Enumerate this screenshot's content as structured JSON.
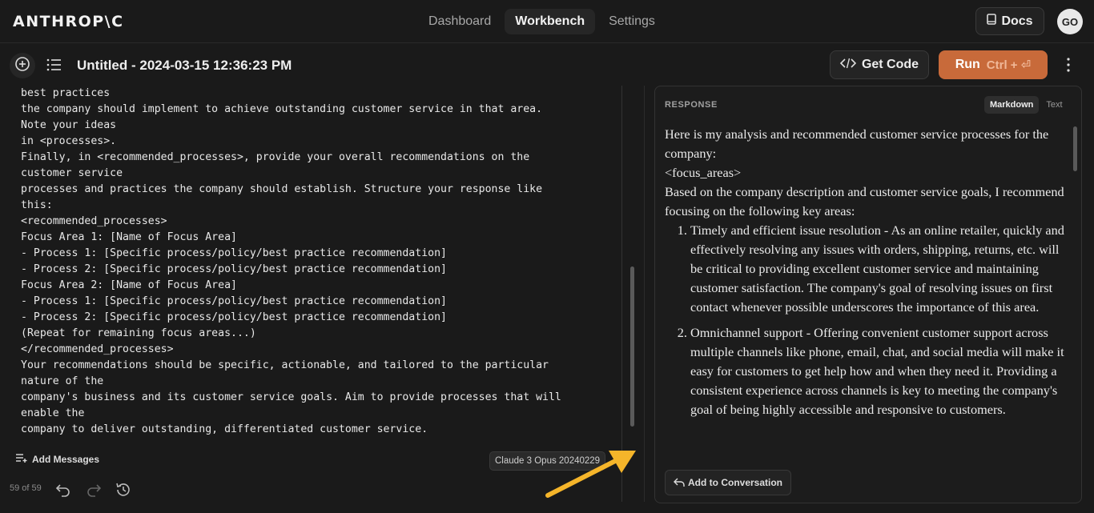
{
  "topnav": {
    "logo": "ANTHROP\\C",
    "tabs": [
      {
        "label": "Dashboard",
        "active": false
      },
      {
        "label": "Workbench",
        "active": true
      },
      {
        "label": "Settings",
        "active": false
      }
    ],
    "docs_label": "Docs",
    "avatar_initials": "GO"
  },
  "toolbar": {
    "title": "Untitled - 2024-03-15 12:36:23 PM",
    "get_code_label": "Get Code",
    "run_label": "Run",
    "run_shortcut": "Ctrl + ⏎"
  },
  "prompt": {
    "text": "best practices\nthe company should implement to achieve outstanding customer service in that area.\nNote your ideas\nin <processes>.\nFinally, in <recommended_processes>, provide your overall recommendations on the\ncustomer service\nprocesses and practices the company should establish. Structure your response like\nthis:\n<recommended_processes>\nFocus Area 1: [Name of Focus Area]\n- Process 1: [Specific process/policy/best practice recommendation]\n- Process 2: [Specific process/policy/best practice recommendation]\nFocus Area 2: [Name of Focus Area]\n- Process 1: [Specific process/policy/best practice recommendation]\n- Process 2: [Specific process/policy/best practice recommendation]\n(Repeat for remaining focus areas...)\n</recommended_processes>\nYour recommendations should be specific, actionable, and tailored to the particular\nnature of the\ncompany's business and its customer service goals. Aim to provide processes that will\nenable the\ncompany to deliver outstanding, differentiated customer service.",
    "add_messages_label": "Add Messages",
    "model_label": "Claude 3 Opus 20240229",
    "counter": "59 of 59"
  },
  "response": {
    "label": "RESPONSE",
    "tabs": [
      {
        "label": "Markdown",
        "active": true
      },
      {
        "label": "Text",
        "active": false
      }
    ],
    "intro": "Here is my analysis and recommended customer service processes for the company:",
    "tag": "<focus_areas>",
    "lead": "Based on the company description and customer service goals, I recommend focusing on the following key areas:",
    "items": [
      "Timely and efficient issue resolution - As an online retailer, quickly and effectively resolving any issues with orders, shipping, returns, etc. will be critical to providing excellent customer service and maintaining customer satisfaction. The company's goal of resolving issues on first contact whenever possible underscores the importance of this area.",
      "Omnichannel support - Offering convenient customer support across multiple channels like phone, email, chat, and social media will make it easy for customers to get help how and when they need it. Providing a consistent experience across channels is key to meeting the company's goal of being highly accessible and responsive to customers."
    ],
    "add_to_conversation_label": "Add to Conversation"
  },
  "colors": {
    "background": "#1a1a1a",
    "run_button": "#c86a3a",
    "annotation_arrow": "#f5b52a"
  }
}
